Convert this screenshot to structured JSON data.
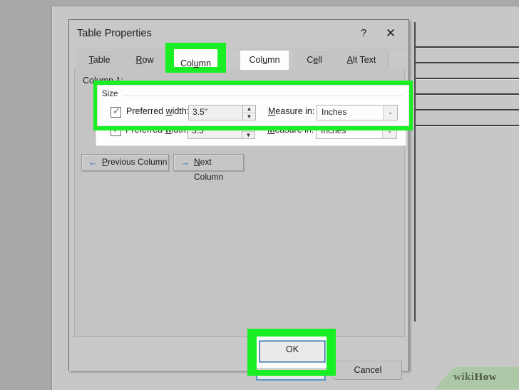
{
  "window": {
    "title": "Table Properties",
    "help_icon": "question-mark-icon",
    "close_icon": "close-x-icon",
    "help_glyph": "?",
    "close_glyph": "✕"
  },
  "tabs": [
    {
      "label": "Table",
      "accel": "T",
      "selected": false
    },
    {
      "label": "Row",
      "accel": "R",
      "selected": false
    },
    {
      "label": "Column",
      "accel": "u",
      "selected": true
    },
    {
      "label": "Cell",
      "accel": "e",
      "selected": false
    },
    {
      "label": "Alt Text",
      "accel": "A",
      "selected": false
    }
  ],
  "panel": {
    "column_label": "Column 1:",
    "size_group": {
      "legend": "Size",
      "checkbox": {
        "label": "Preferred width:",
        "checked": true,
        "check_glyph": "✓"
      },
      "spinner": {
        "value": "3.5\"",
        "up_glyph": "▲",
        "down_glyph": "▼"
      },
      "measure_label": "Measure in:",
      "measure_value": "Inches",
      "measure_arrow_glyph": "⌄"
    },
    "nav_buttons": [
      {
        "label": "Previous Column",
        "arrow": "←"
      },
      {
        "label": "Next Column",
        "arrow": "→"
      }
    ]
  },
  "footer": {
    "ok": "OK",
    "cancel": "Cancel"
  },
  "highlights": {
    "color": "#1aee25",
    "targets": [
      "Column tab",
      "Size group",
      "OK button"
    ]
  },
  "watermark": {
    "wiki": "wiki",
    "how": "How"
  }
}
